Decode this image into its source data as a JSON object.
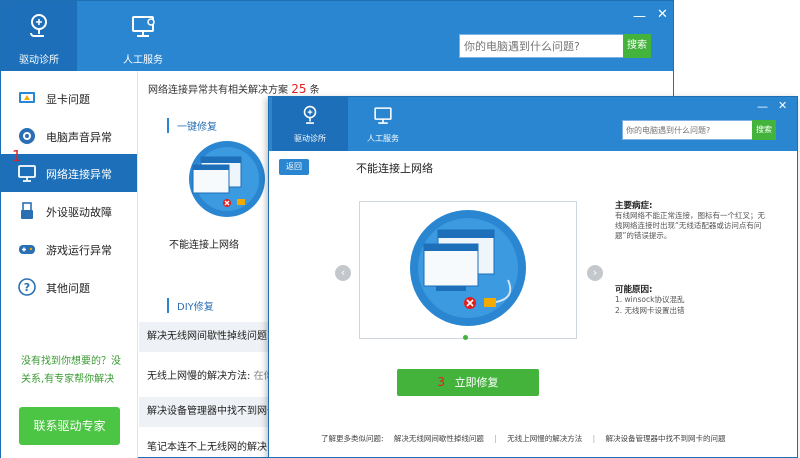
{
  "back_window": {
    "tabs": [
      {
        "label": "驱动诊所",
        "icon": "stethoscope-icon",
        "active": true
      },
      {
        "label": "人工服务",
        "icon": "monitor-support-icon",
        "active": false
      }
    ],
    "search": {
      "placeholder": "你的电脑遇到什么问题?",
      "button": "搜索"
    },
    "sidebar": {
      "items": [
        {
          "label": "显卡问题",
          "icon": "graphics-card-icon"
        },
        {
          "label": "电脑声音异常",
          "icon": "speaker-icon"
        },
        {
          "label": "网络连接异常",
          "icon": "monitor-icon",
          "active": true
        },
        {
          "label": "外设驱动故障",
          "icon": "usb-icon"
        },
        {
          "label": "游戏运行异常",
          "icon": "gamepad-icon"
        },
        {
          "label": "其他问题",
          "icon": "question-icon"
        }
      ],
      "marker": "1",
      "help_text": "没有找到你想要的？没关系,有专家帮你解决",
      "expert_button": "联系驱动专家"
    },
    "summary": {
      "prefix": "网络连接异常共有相关解决方案",
      "count": "25",
      "suffix": "条"
    },
    "one_click_title": "一键修复",
    "card_marker": "2",
    "card_label": "不能连接上网络",
    "diy_title": "DIY修复",
    "solutions": [
      {
        "title": "解决无线网间歇性掉线问题",
        "extra": ""
      },
      {
        "title": "无线上网慢的解决方法:",
        "extra": "在你"
      },
      {
        "title": "解决设备管理器中找不到网卡",
        "extra": ""
      },
      {
        "title": "笔记本连不上无线网的解决",
        "extra": ""
      }
    ]
  },
  "front_window": {
    "tabs": [
      {
        "label": "驱动诊所",
        "icon": "stethoscope-icon",
        "active": true
      },
      {
        "label": "人工服务",
        "icon": "monitor-support-icon",
        "active": false
      }
    ],
    "search": {
      "placeholder": "你的电脑遇到什么问题?",
      "button": "搜索"
    },
    "back_button": "返回",
    "title": "不能连接上网络",
    "symptoms": {
      "heading": "主要病症:",
      "text": "有线网络不能正常连接，图标有一个红叉；无线网络连接时出现“无线适配器或访问点有问题”的错误提示。"
    },
    "causes": {
      "heading": "可能原因:",
      "items": [
        "1. winsock协议混乱",
        "2. 无线网卡设置出错"
      ]
    },
    "fix_marker": "3",
    "fix_button": "立即修复",
    "footer": {
      "label": "了解更多类似问题:",
      "links": [
        "解决无线网间歇性掉线问题",
        "无线上网慢的解决方法",
        "解决设备管理器中找不到网卡的问题"
      ]
    }
  },
  "colors": {
    "header": "#2a86d0",
    "active": "#1c6fb8",
    "green": "#44b33c",
    "red": "#e02020"
  }
}
